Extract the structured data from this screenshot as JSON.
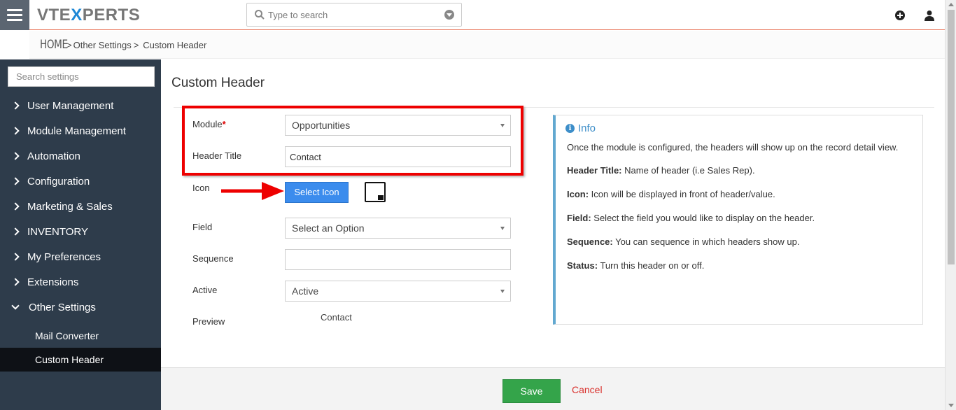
{
  "app": {
    "logo_prefix": "VTE",
    "logo_x": "X",
    "logo_suffix": "PERTS"
  },
  "search": {
    "placeholder": "Type to search"
  },
  "breadcrumb": {
    "home": "HOME",
    "sep1": ">",
    "item1": "Other Settings",
    "sep2": ">",
    "item2": "Custom Header"
  },
  "sidebar": {
    "search_placeholder": "Search settings",
    "items": [
      {
        "label": "User Management"
      },
      {
        "label": "Module Management"
      },
      {
        "label": "Automation"
      },
      {
        "label": "Configuration"
      },
      {
        "label": "Marketing & Sales"
      },
      {
        "label": "INVENTORY"
      },
      {
        "label": "My Preferences"
      },
      {
        "label": "Extensions"
      },
      {
        "label": "Other Settings"
      }
    ],
    "subitems": [
      {
        "label": "Mail Converter"
      },
      {
        "label": "Custom Header"
      }
    ]
  },
  "main": {
    "title": "Custom Header",
    "form": {
      "module_label": "Module",
      "module_required": "*",
      "module_value": "Opportunities",
      "header_title_label": "Header Title",
      "header_title_value": "Contact",
      "icon_label": "Icon",
      "select_icon_button": "Select Icon",
      "field_label": "Field",
      "field_value": "Select an Option",
      "sequence_label": "Sequence",
      "sequence_value": "",
      "active_label": "Active",
      "active_value": "Active",
      "preview_label": "Preview",
      "preview_value": "Contact"
    },
    "info": {
      "title": "Info",
      "icon_glyph": "i",
      "intro": "Once the module is configured, the headers will show up on the record detail view.",
      "lines": [
        {
          "key": "Header Title:",
          "text": " Name of header (i.e Sales Rep)."
        },
        {
          "key": "Icon:",
          "text": " Icon will be displayed in front of header/value."
        },
        {
          "key": "Field:",
          "text": " Select the field you would like to display on the header."
        },
        {
          "key": "Sequence:",
          "text": " You can sequence in which headers show up."
        },
        {
          "key": "Status:",
          "text": " Turn this header on or off."
        }
      ]
    }
  },
  "footer": {
    "save_label": "Save",
    "cancel_label": "Cancel"
  },
  "colors": {
    "accent": "#3b8ced",
    "save": "#34a44a",
    "cancel": "#d9302c",
    "sidebar": "#2e3c4b",
    "highlight_box": "#e00000"
  }
}
